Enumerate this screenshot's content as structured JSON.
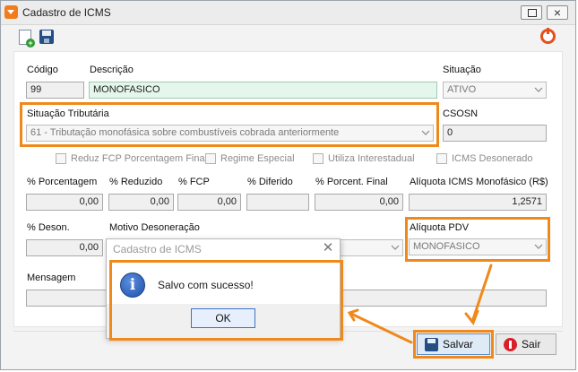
{
  "window": {
    "title": "Cadastro de ICMS"
  },
  "form": {
    "codigo_label": "Código",
    "codigo_value": "99",
    "descricao_label": "Descrição",
    "descricao_value": "MONOFASICO",
    "situacao_label": "Situação",
    "situacao_value": "ATIVO",
    "sit_trib_label": "Situação Tributária",
    "sit_trib_value": "61 - Tributação monofásica sobre combustíveis cobrada anteriormente",
    "csosn_label": "CSOSN",
    "csosn_value": "0",
    "checkboxes": {
      "reduz_fcp": "Reduz FCP Porcentagem Final",
      "regime_especial": "Regime Especial",
      "utiliza_interestadual": "Utiliza Interestadual",
      "icms_desonerado": "ICMS Desonerado"
    },
    "pct_porcentagem_label": "% Porcentagem",
    "pct_porcentagem_value": "0,00",
    "pct_reduzido_label": "% Reduzido",
    "pct_reduzido_value": "0,00",
    "pct_fcp_label": "% FCP",
    "pct_fcp_value": "0,00",
    "pct_diferido_label": "% Diferido",
    "pct_diferido_value": "",
    "pct_final_label": "% Porcent. Final",
    "pct_final_value": "0,00",
    "aliquota_mono_label": "Alíquota ICMS Monofásico (R$)",
    "aliquota_mono_value": "1,2571",
    "pct_deson_label": "% Deson.",
    "pct_deson_value": "0,00",
    "motivo_label": "Motivo Desoneração",
    "motivo_value": "",
    "aliquota_pdv_label": "Alíquota PDV",
    "aliquota_pdv_value": "MONOFASICO",
    "mensagem_label": "Mensagem",
    "mensagem_value": ""
  },
  "buttons": {
    "salvar": "Salvar",
    "sair": "Sair"
  },
  "dialog": {
    "title": "Cadastro de ICMS",
    "message": "Salvo com sucesso!",
    "ok": "OK"
  },
  "colors": {
    "highlight": "#f0891c",
    "accent_blue": "#3f73c5"
  }
}
